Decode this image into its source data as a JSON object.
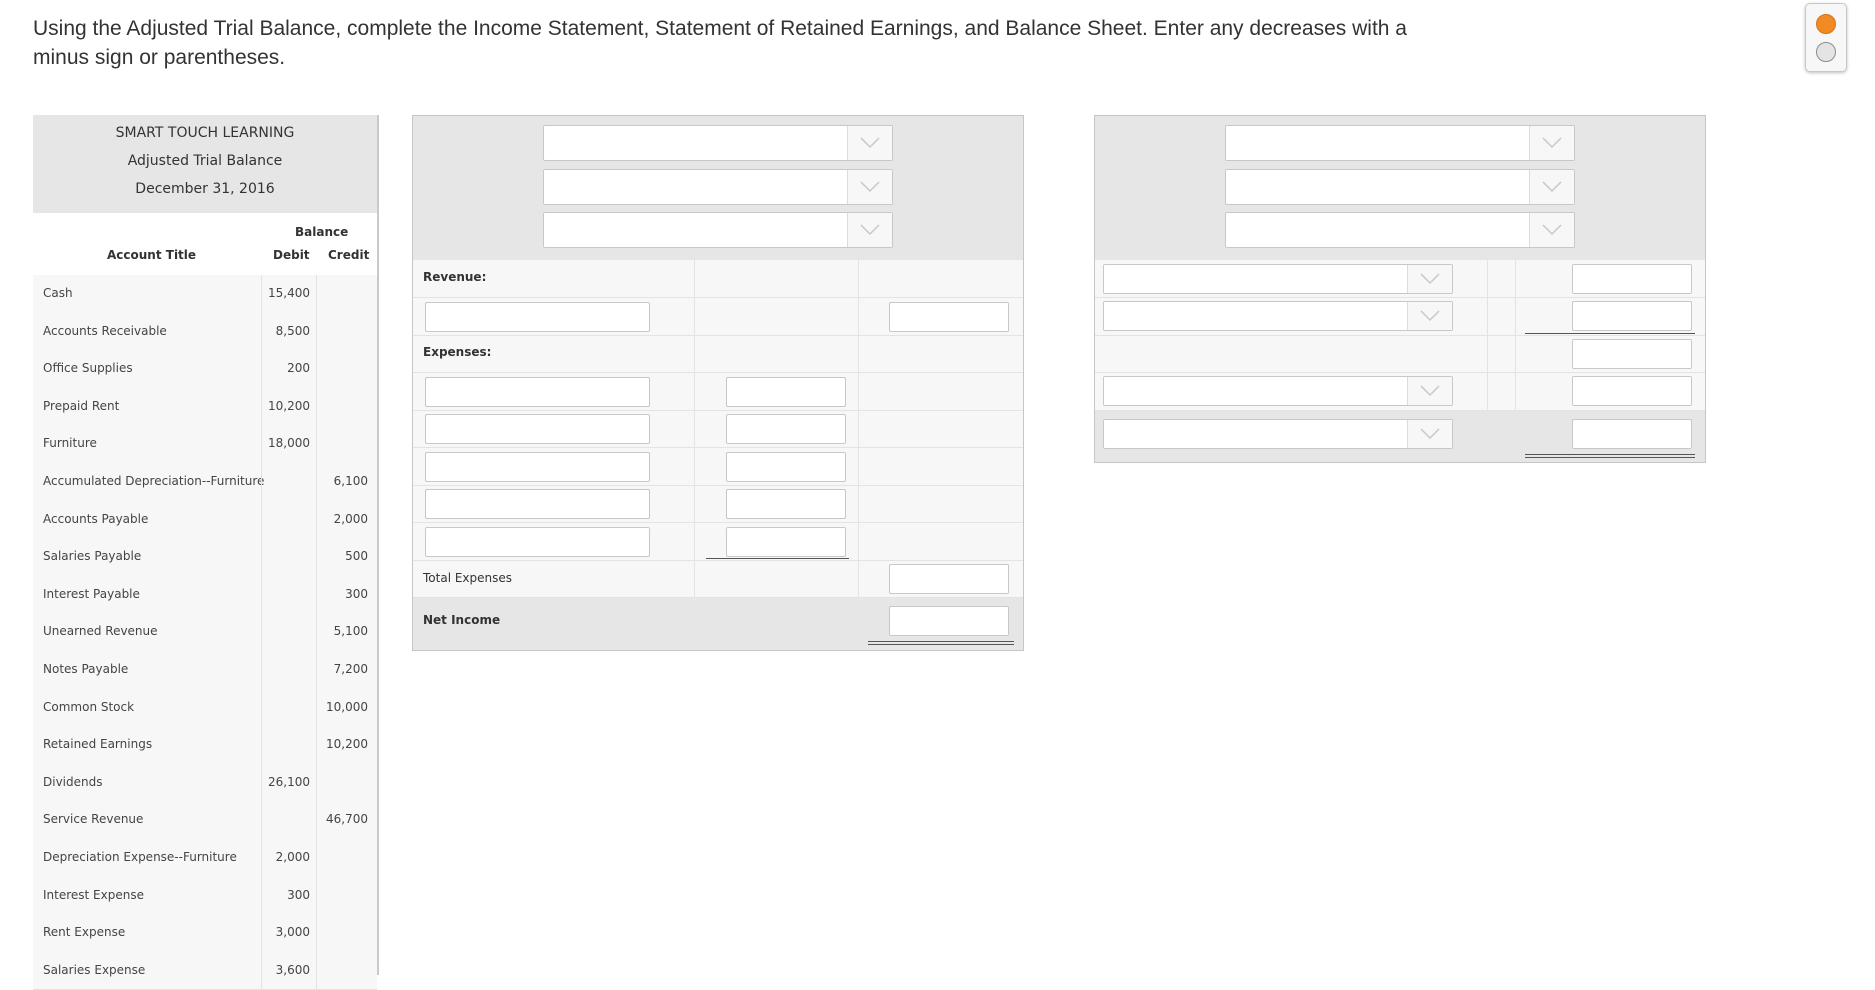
{
  "instructions": "Using the Adjusted Trial Balance, complete the Income Statement, Statement of Retained Earnings, and Balance Sheet. Enter any decreases with a minus sign or parentheses.",
  "trial_balance": {
    "company": "SMART TOUCH LEARNING",
    "title": "Adjusted Trial Balance",
    "date": "December 31, 2016",
    "balance_header": "Balance",
    "col_account": "Account Title",
    "col_debit": "Debit",
    "col_credit": "Credit",
    "rows": [
      {
        "account": "Cash",
        "debit": "15,400",
        "credit": ""
      },
      {
        "account": "Accounts Receivable",
        "debit": "8,500",
        "credit": ""
      },
      {
        "account": "Office Supplies",
        "debit": "200",
        "credit": ""
      },
      {
        "account": "Prepaid Rent",
        "debit": "10,200",
        "credit": ""
      },
      {
        "account": "Furniture",
        "debit": "18,000",
        "credit": ""
      },
      {
        "account": "Accumulated Depreciation--Furniture",
        "debit": "",
        "credit": "6,100"
      },
      {
        "account": "Accounts Payable",
        "debit": "",
        "credit": "2,000"
      },
      {
        "account": "Salaries Payable",
        "debit": "",
        "credit": "500"
      },
      {
        "account": "Interest Payable",
        "debit": "",
        "credit": "300"
      },
      {
        "account": "Unearned Revenue",
        "debit": "",
        "credit": "5,100"
      },
      {
        "account": "Notes Payable",
        "debit": "",
        "credit": "7,200"
      },
      {
        "account": "Common Stock",
        "debit": "",
        "credit": "10,000"
      },
      {
        "account": "Retained Earnings",
        "debit": "",
        "credit": "10,200"
      },
      {
        "account": "Dividends",
        "debit": "26,100",
        "credit": ""
      },
      {
        "account": "Service Revenue",
        "debit": "",
        "credit": "46,700"
      },
      {
        "account": "Depreciation Expense--Furniture",
        "debit": "2,000",
        "credit": ""
      },
      {
        "account": "Interest Expense",
        "debit": "300",
        "credit": ""
      },
      {
        "account": "Rent Expense",
        "debit": "3,000",
        "credit": ""
      },
      {
        "account": "Salaries Expense",
        "debit": "3,600",
        "credit": ""
      }
    ]
  },
  "income_statement": {
    "revenue_label": "Revenue:",
    "expenses_label": "Expenses:",
    "total_expenses_label": "Total Expenses",
    "net_income_label": "Net Income"
  },
  "icons": {
    "dropdown_caret": "chevron-down-icon",
    "selected_radio_color": "#f08a24"
  }
}
